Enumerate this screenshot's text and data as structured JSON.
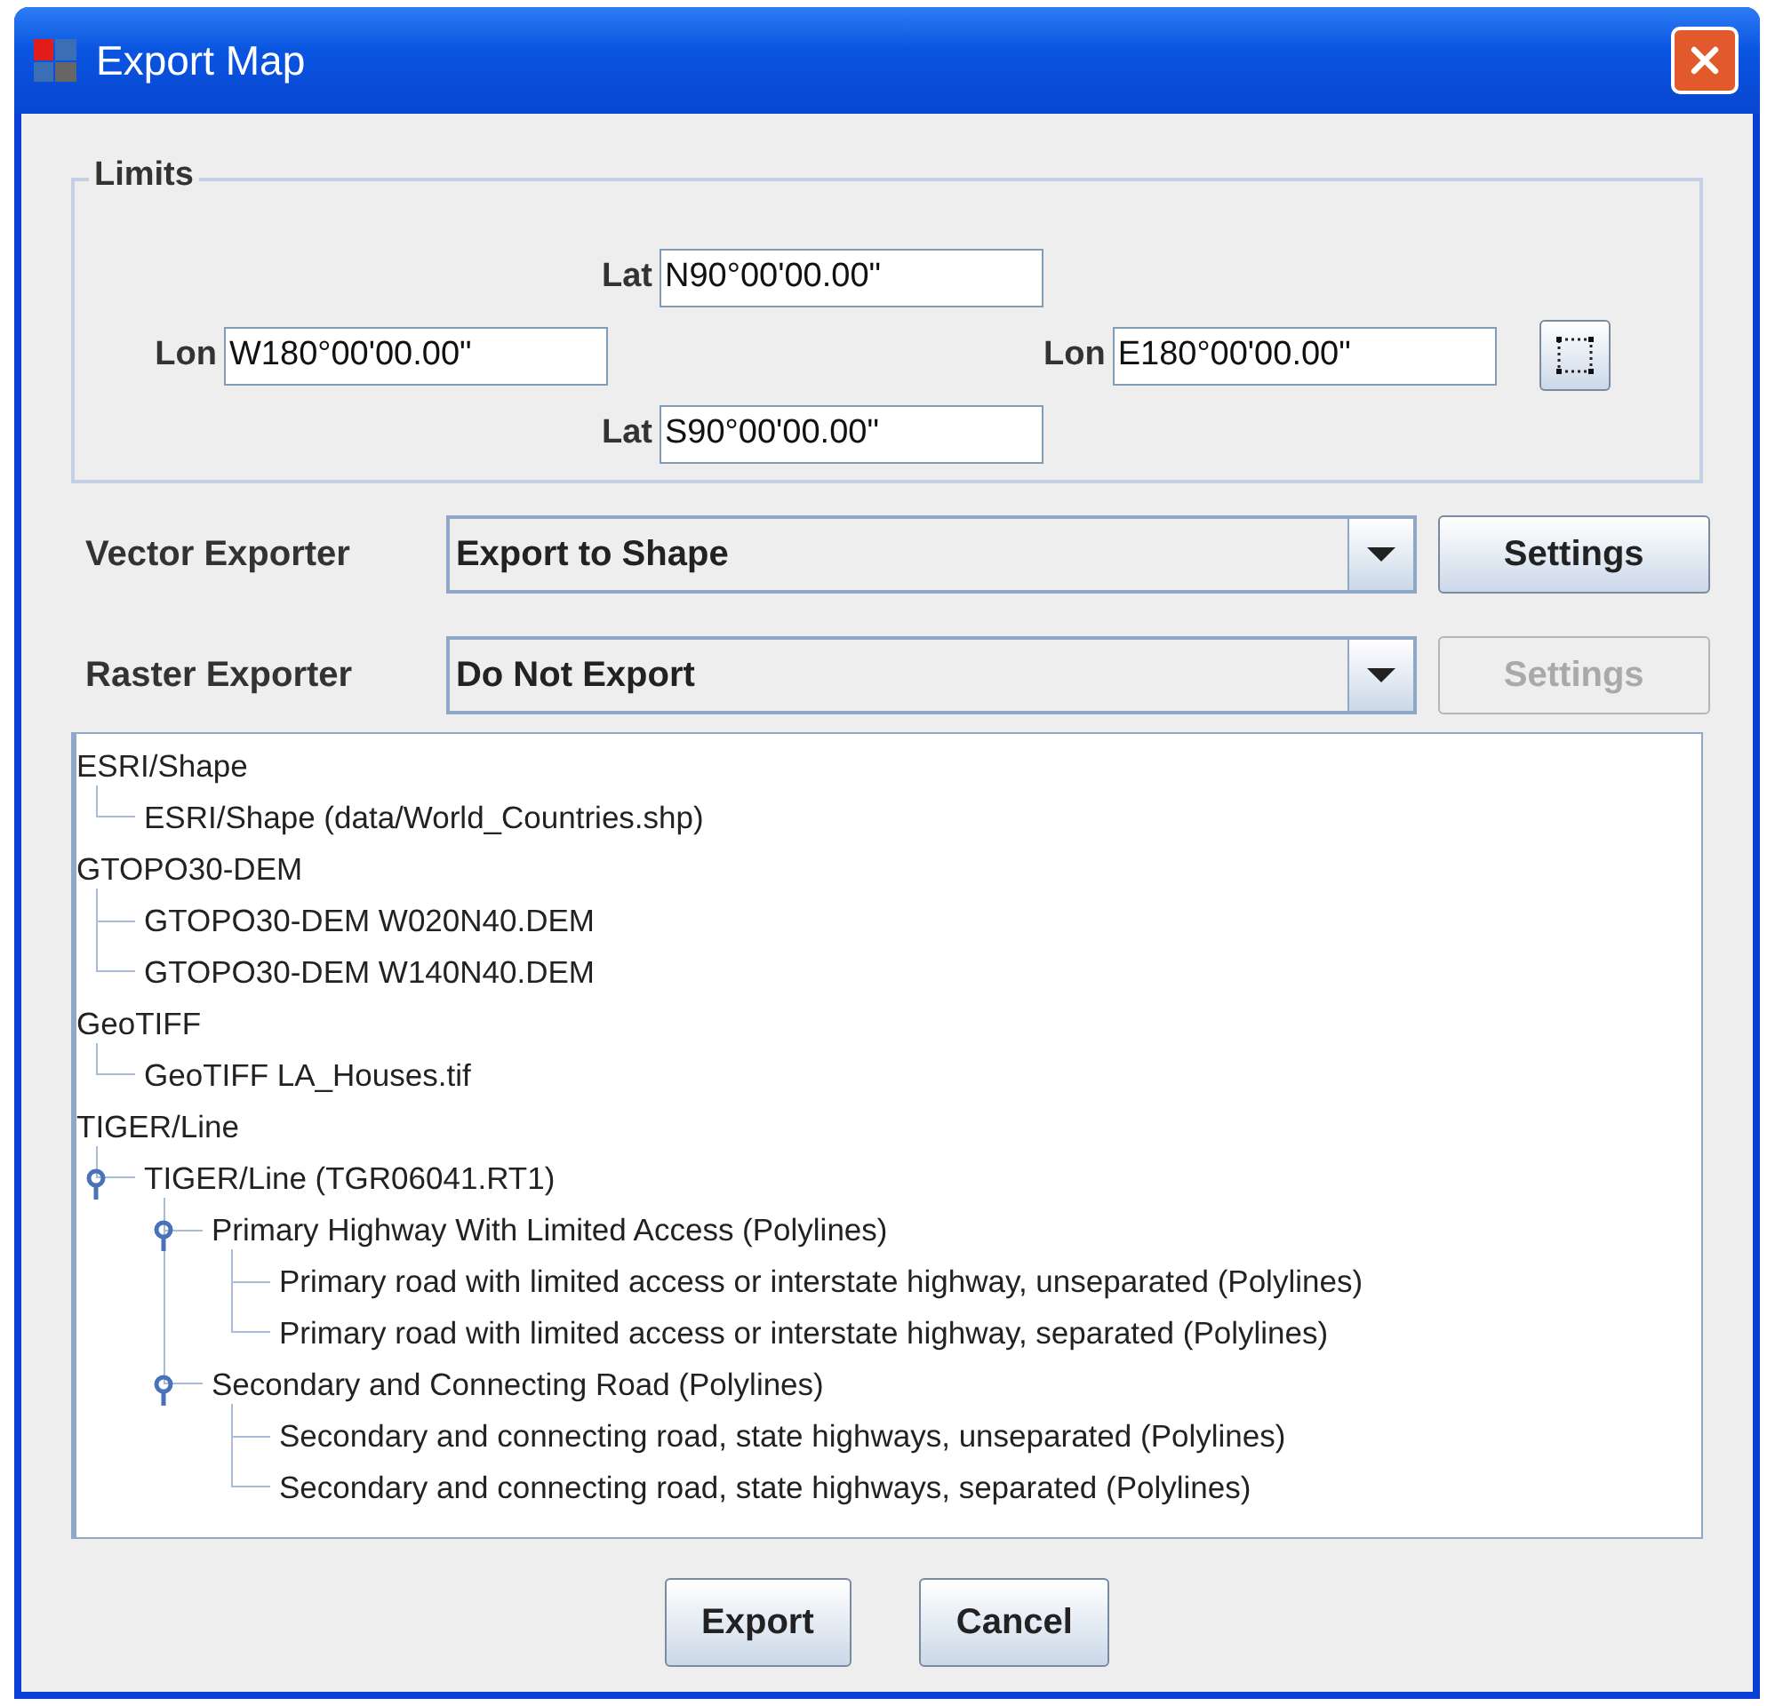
{
  "window": {
    "title": "Export Map"
  },
  "limits": {
    "title": "Limits",
    "north": {
      "label": "Lat",
      "value": "N90°00'00.00\""
    },
    "west": {
      "label": "Lon",
      "value": "W180°00'00.00\""
    },
    "east": {
      "label": "Lon",
      "value": "E180°00'00.00\""
    },
    "south": {
      "label": "Lat",
      "value": "S90°00'00.00\""
    }
  },
  "exporters": [
    {
      "label": "Vector Exporter",
      "value": "Export to Shape",
      "settings": {
        "label": "Settings",
        "disabled": false
      }
    },
    {
      "label": "Raster Exporter",
      "value": "Do Not Export",
      "settings": {
        "label": "Settings",
        "disabled": true
      }
    }
  ],
  "tree": [
    {
      "label": "ESRI/Shape",
      "children": [
        {
          "label": "ESRI/Shape (data/World_Countries.shp)"
        }
      ]
    },
    {
      "label": "GTOPO30-DEM",
      "children": [
        {
          "label": "GTOPO30-DEM W020N40.DEM"
        },
        {
          "label": "GTOPO30-DEM W140N40.DEM"
        }
      ]
    },
    {
      "label": "GeoTIFF",
      "children": [
        {
          "label": "GeoTIFF LA_Houses.tif"
        }
      ]
    },
    {
      "label": "TIGER/Line",
      "children": [
        {
          "label": "TIGER/Line (TGR06041.RT1)",
          "expanded": true,
          "children": [
            {
              "label": "Primary Highway With Limited Access (Polylines)",
              "expanded": true,
              "children": [
                {
                  "label": "Primary road with limited access or interstate highway, unseparated (Polylines)"
                },
                {
                  "label": "Primary road with limited access or interstate highway, separated (Polylines)"
                }
              ]
            },
            {
              "label": "Secondary and Connecting Road (Polylines)",
              "expanded": true,
              "children": [
                {
                  "label": "Secondary and connecting road, state highways, unseparated (Polylines)"
                },
                {
                  "label": "Secondary and connecting road, state highways, separated (Polylines)"
                }
              ]
            }
          ]
        }
      ]
    }
  ],
  "buttons": [
    "Export",
    "Cancel"
  ]
}
